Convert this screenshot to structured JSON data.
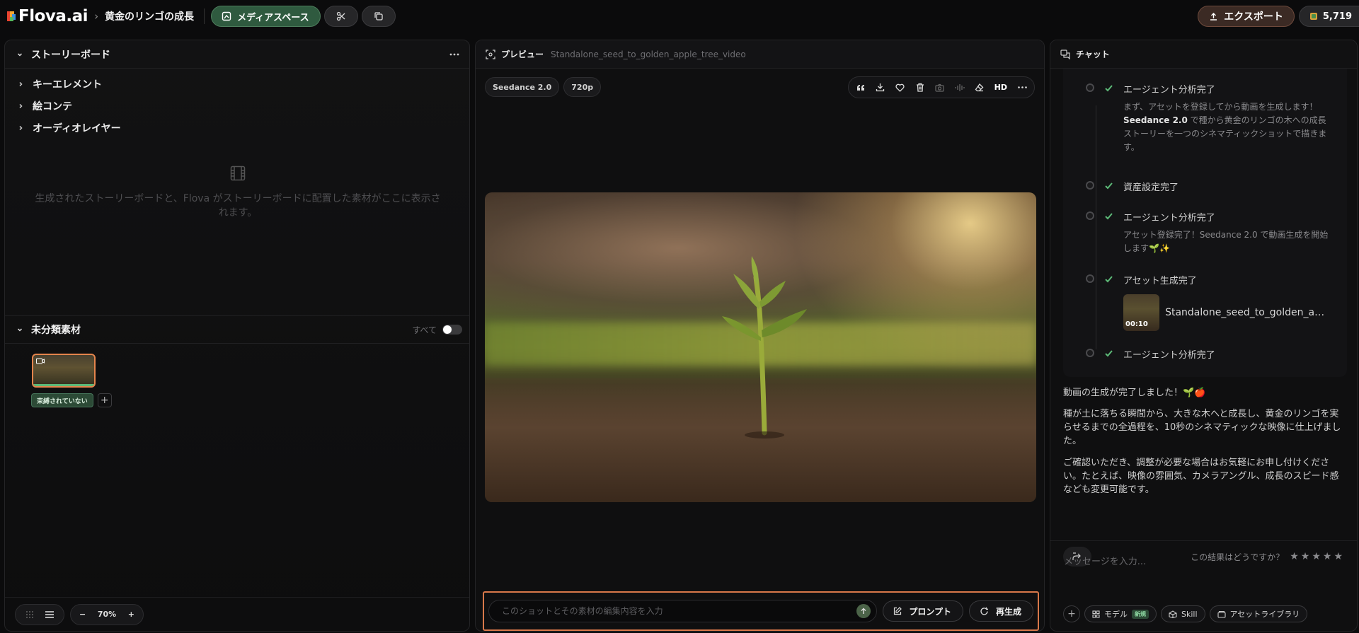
{
  "app": {
    "logo_text": "Flova.ai",
    "project_title": "黄金のリンゴの成長",
    "crumb_sep": "›"
  },
  "topbar": {
    "media_space_label": "メディアスペース",
    "export_label": "エクスポート",
    "credits": "5,719"
  },
  "left_panel": {
    "title": "ストーリーボード",
    "tree": [
      "キーエレメント",
      "絵コンテ",
      "オーディオレイヤー"
    ],
    "empty_text": "生成されたストーリーボードと、Flova がストーリーボードに配置した素材がここに表示されます。",
    "unsorted_title": "未分類素材",
    "all_label": "すべて",
    "unbound_tag": "束縛されていない",
    "zoom": "70%",
    "zoom_minus": "−",
    "zoom_plus": "+"
  },
  "preview": {
    "label": "プレビュー",
    "file_name": "Standalone_seed_to_golden_apple_tree_video",
    "chips": [
      "Seedance 2.0",
      "720p"
    ],
    "hd_label": "HD",
    "edit_placeholder": "このショットとその素材の編集内容を入力",
    "prompt_label": "プロンプト",
    "regen_label": "再生成"
  },
  "chat": {
    "title": "チャット",
    "steps": [
      {
        "label": "エージェント分析完了",
        "text_pre": "まず、アセットを登録してから動画を生成します！",
        "bold": "Seedance 2.0",
        "text_post": " で種から黄金のリンゴの木への成長ストーリーを一つのシネマティックショットで描きます。"
      },
      {
        "label": "資産設定完了"
      },
      {
        "label": "エージェント分析完了",
        "text": "アセット登録完了！Seedance 2.0 で動画生成を開始します🌱✨"
      },
      {
        "label": "アセット生成完了",
        "asset_name": "Standalone_seed_to_golden_apple...",
        "asset_time": "00:10"
      },
      {
        "label": "エージェント分析完了"
      }
    ],
    "messages": [
      "動画の生成が完了しました！🌱🍎",
      "種が土に落ちる瞬間から、大きな木へと成長し、黄金のリンゴを実らせるまでの全過程を、10秒のシネマティックな映像に仕上げました。",
      "ご確認いただき、調整が必要な場合はお気軽にお申し付けください。たとえば、映像の雰囲気、カメラアングル、成長のスピード感なども変更可能です。"
    ],
    "rating_question": "この結果はどうですか？",
    "rating": 0,
    "input_placeholder": "メッセージを入力...",
    "model_label": "モデル",
    "new_badge": "新規",
    "skill_label": "Skill",
    "library_label": "アセットライブラリ"
  },
  "colors": {
    "accent_green": "#2f5a3f",
    "export_brown": "#3b2a24",
    "highlight_orange": "#d8784a",
    "check_green": "#5dba78"
  }
}
